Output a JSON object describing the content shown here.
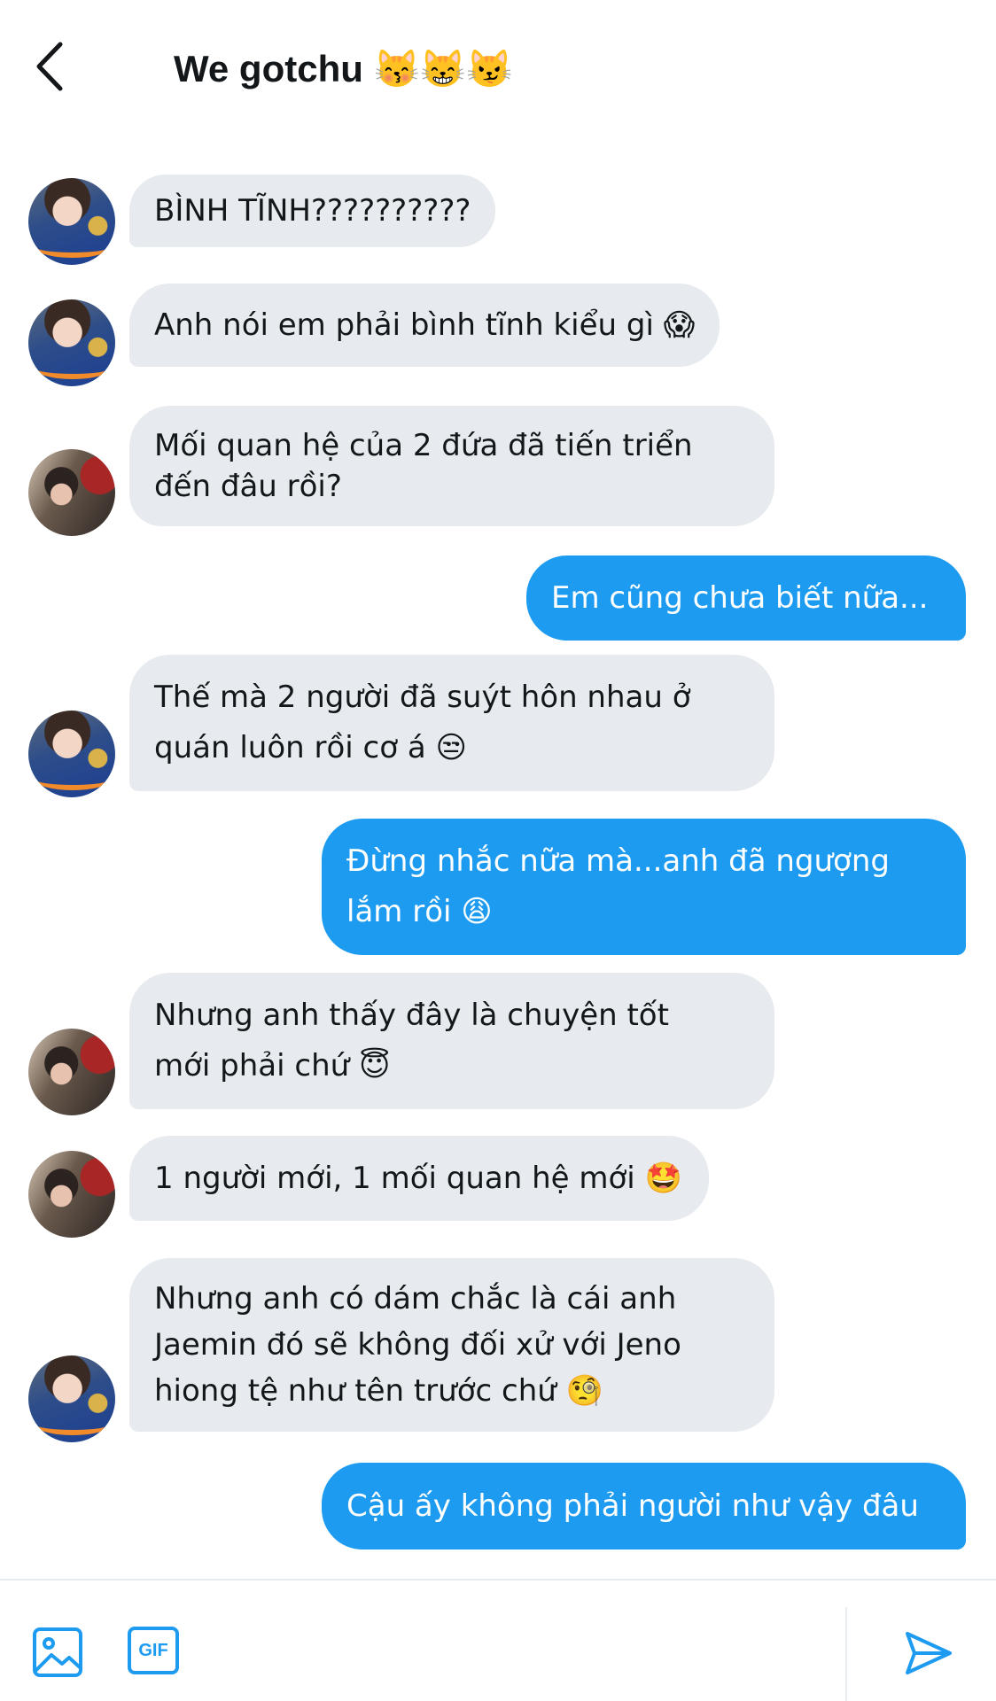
{
  "header": {
    "title": "We gotchu 😽😸😼"
  },
  "messages": [
    {
      "side": "in",
      "lines": [
        "BÌNH TĨNH??????????"
      ]
    },
    {
      "side": "in",
      "lines": [
        "Anh nói em phải bình tĩnh kiểu gì 😱"
      ]
    },
    {
      "side": "in",
      "lines": [
        "Mối quan hệ của 2 đứa đã tiến triển",
        "đến đâu rồi?"
      ]
    },
    {
      "side": "out",
      "lines": [
        "Em cũng chưa biết nữa..."
      ]
    },
    {
      "side": "in",
      "lines": [
        "Thế mà 2 người đã suýt hôn nhau ở",
        "quán luôn rồi cơ á 😒"
      ]
    },
    {
      "side": "out",
      "lines": [
        "Đừng nhắc nữa mà...anh đã ngượng",
        "lắm rồi 😩"
      ]
    },
    {
      "side": "in",
      "lines": [
        "Nhưng anh thấy đây là chuyện tốt",
        "mới phải chứ 😇"
      ]
    },
    {
      "side": "in",
      "lines": [
        "1 người mới, 1 mối quan hệ mới 🤩"
      ]
    },
    {
      "side": "in",
      "lines": [
        "Nhưng anh có dám chắc là cái anh",
        "Jaemin đó sẽ không đối xử với Jeno",
        "hiong tệ như tên trước chứ 🧐"
      ]
    },
    {
      "side": "out",
      "lines": [
        "Cậu ấy không phải người như vậy đâu"
      ]
    }
  ],
  "composer": {
    "gif_label": "GIF"
  },
  "colors": {
    "accent": "#1d9bf0",
    "incoming_bubble": "#e7eaee"
  },
  "icons": {
    "back": "back-arrow-icon",
    "image": "image-icon",
    "gif": "gif-icon",
    "send": "send-icon"
  }
}
